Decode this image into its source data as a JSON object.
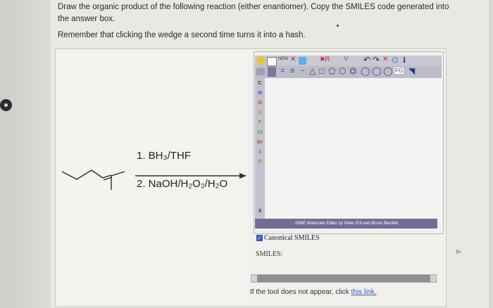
{
  "question": {
    "instruction": "Draw the organic product of the following reaction (either enantiomer). Copy the SMILES code generated into the answer box.",
    "reminder": "Remember that clicking the wedge a second time turns it into a hash."
  },
  "reaction": {
    "step1": "1. BH₃/THF",
    "step2": "2. NaOH/H₂O₂/H₂O"
  },
  "editor": {
    "new_label": "NEW",
    "fg_label": "FG",
    "atoms": [
      "C",
      "N",
      "O",
      "S",
      "F",
      "Cl",
      "Br",
      "I",
      "P",
      "X"
    ],
    "credit": "JSME Molecular Editor by Peter Ertl and Bruno Bienfait",
    "canonical_smiles_label": "Canonical SMILES",
    "canonical_checked": true,
    "smiles_label": "SMILES:",
    "smiles_value": ""
  },
  "footer": {
    "tool_text": "If the tool does not appear, click ",
    "link_text": "this link."
  }
}
